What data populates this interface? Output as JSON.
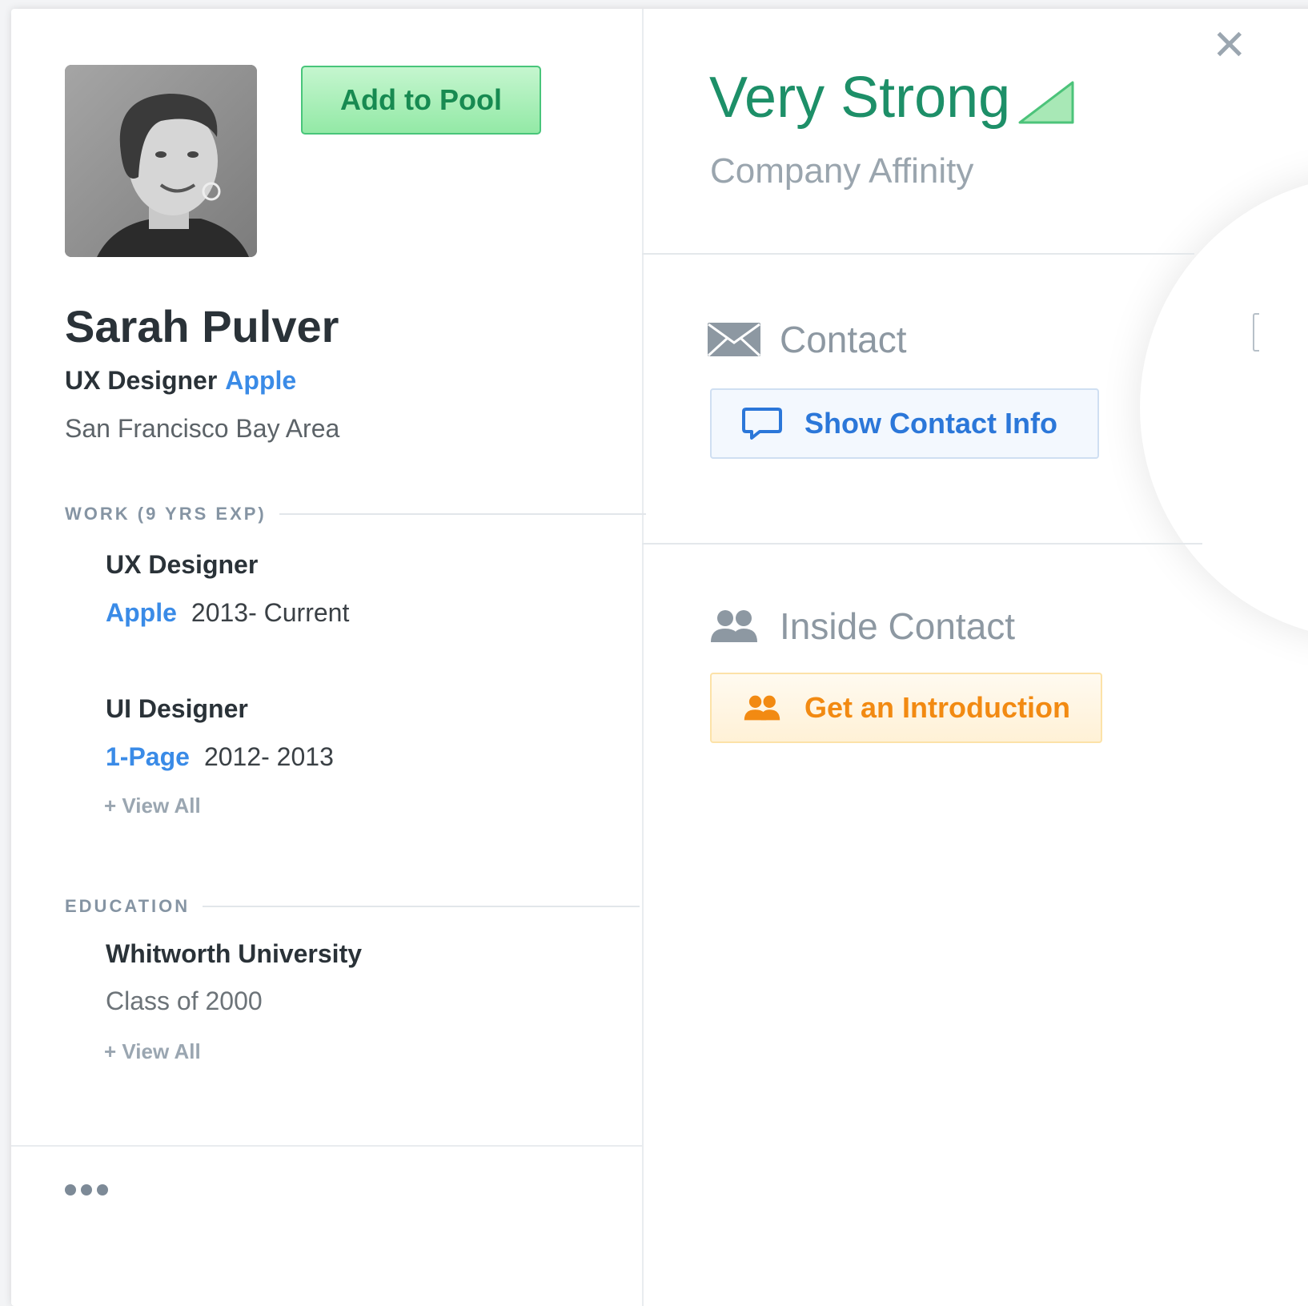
{
  "profile": {
    "name": "Sarah Pulver",
    "title": "UX Designer",
    "company": "Apple",
    "location": "San Francisco Bay Area",
    "add_button": "Add to Pool"
  },
  "work": {
    "heading": "WORK (9 YRS EXP)",
    "jobs": [
      {
        "title": "UX Designer",
        "company": "Apple",
        "dates": "2013- Current"
      },
      {
        "title": "UI Designer",
        "company": "1-Page",
        "dates": "2012- 2013"
      }
    ],
    "view_all": "+ View All"
  },
  "education": {
    "heading": "EDUCATION",
    "school": "Whitworth University",
    "class": "Class of 2000",
    "view_all": "+ View All"
  },
  "affinity": {
    "value": "Very Strong",
    "label": "Company Affinity",
    "color": "#1d8f68"
  },
  "contact": {
    "heading": "Contact",
    "button": "Show Contact Info"
  },
  "inside_contact": {
    "heading": "Inside Contact",
    "button": "Get an Introduction"
  },
  "icons": {
    "close": "close-icon",
    "envelope": "envelope-icon",
    "chat": "chat-bubble-icon",
    "people": "people-icon",
    "more": "more-dots-icon",
    "signal": "signal-strength-icon"
  },
  "colors": {
    "link_blue": "#3a8be7",
    "accent_green": "#48c57a",
    "accent_orange": "#f28a12"
  }
}
